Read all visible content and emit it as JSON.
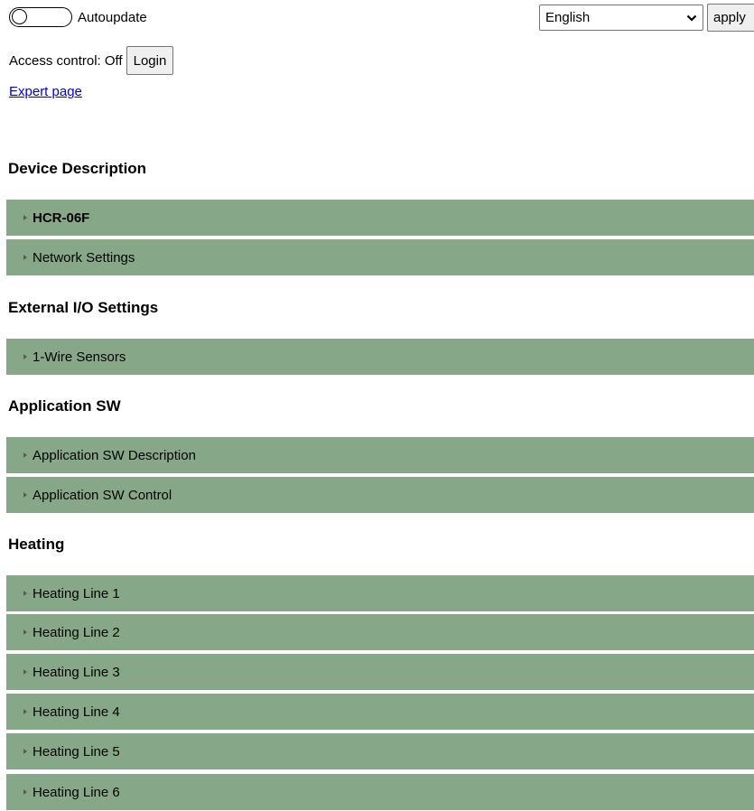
{
  "header": {
    "autoupdate_label": "Autoupdate",
    "language": {
      "selected": "English",
      "apply_label": "apply"
    },
    "access_control_text": "Access control: Off",
    "login_label": "Login",
    "expert_link": "Expert page"
  },
  "sections": [
    {
      "heading": "Device Description",
      "items": [
        {
          "label": "HCR-06F"
        },
        {
          "label": "Network Settings"
        }
      ]
    },
    {
      "heading": "External I/O Settings",
      "items": [
        {
          "label": "1-Wire Sensors"
        }
      ]
    },
    {
      "heading": "Application SW",
      "items": [
        {
          "label": "Application SW Description"
        },
        {
          "label": "Application SW Control"
        }
      ]
    },
    {
      "heading": "Heating",
      "items": [
        {
          "label": "Heating Line 1"
        },
        {
          "label": "Heating Line 2"
        },
        {
          "label": "Heating Line 3"
        },
        {
          "label": "Heating Line 4"
        },
        {
          "label": "Heating Line 5"
        },
        {
          "label": "Heating Line 6"
        }
      ]
    }
  ],
  "colors": {
    "bar_background": "#87a888",
    "link": "#0000ee"
  }
}
